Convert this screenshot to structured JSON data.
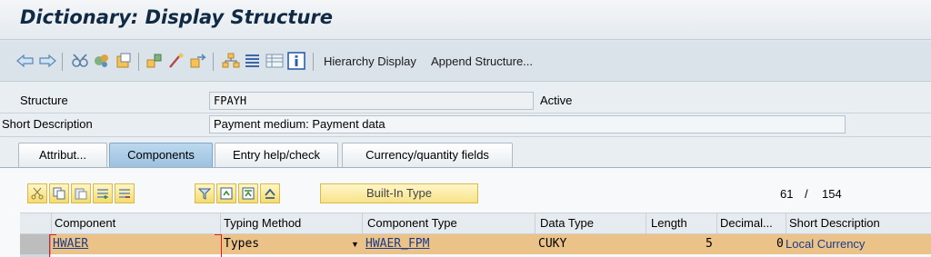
{
  "title": "Dictionary: Display Structure",
  "toolbar": {
    "hierarchy_display": "Hierarchy Display",
    "append_structure": "Append Structure...",
    "icons": [
      "back-arrow-icon",
      "forward-arrow-icon",
      "other-object-icon",
      "display-change-icon",
      "check-icon",
      "where-used-icon",
      "activate-icon",
      "object-list-icon",
      "navigation-window-icon",
      "hierarchy-icon",
      "list-icon",
      "info-icon"
    ]
  },
  "header": {
    "structure_label": "Structure",
    "structure_value": "FPAYH",
    "status": "Active",
    "short_desc_label": "Short Description",
    "short_desc_value": "Payment medium: Payment data"
  },
  "tabs": [
    {
      "label": "Attribut..."
    },
    {
      "label": "Components",
      "active": true
    },
    {
      "label": "Entry help/check"
    },
    {
      "label": "Currency/quantity fields"
    }
  ],
  "grid": {
    "builtin_type_label": "Built-In Type",
    "position_current": "61",
    "position_separator": "/",
    "position_total": "154",
    "columns": [
      "Component",
      "Typing Method",
      "Component Type",
      "Data Type",
      "Length",
      "Decimal...",
      "Short Description"
    ],
    "rows": [
      {
        "component": "HWAER",
        "typing_method": "Types",
        "component_type": "HWAER_FPM",
        "data_type": "CUKY",
        "length": "5",
        "decimals": "0",
        "short_description": "Local Currency"
      }
    ]
  },
  "colors": {
    "accent": "#9cc2e0",
    "selected_row": "#ebc389",
    "button_yellow": "#f4dc6c"
  }
}
